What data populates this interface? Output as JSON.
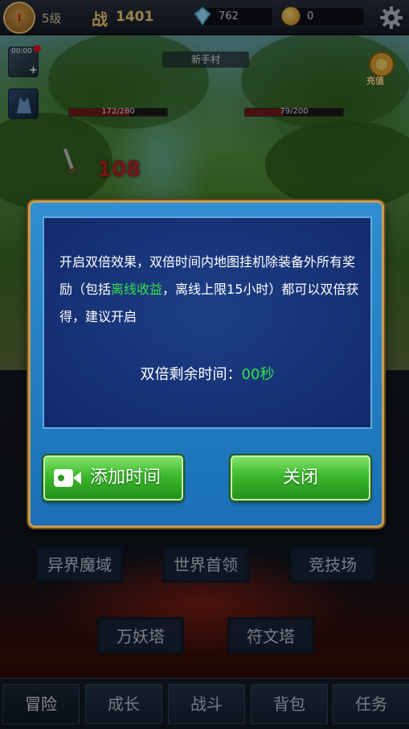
{
  "top_bar": {
    "rank": "1",
    "level": "5级",
    "power_icon": "战",
    "power": "1401",
    "diamonds": "762",
    "gold": "0"
  },
  "scene": {
    "map_name": "新手村",
    "timer": "00:00",
    "recharge_label": "充值",
    "player_hp": "172/280",
    "enemy_hp": "79/200",
    "player_hp_fraction": 0.614,
    "enemy_hp_fraction": 0.395,
    "damage": "108"
  },
  "dialog": {
    "text_before": "开启双倍效果，双倍时间内地图挂机除装备外所有奖励（包括",
    "text_highlight": "离线收益",
    "text_after": "，离线上限15小时）都可以双倍获得，建议开启",
    "timer_label": "双倍剩余时间：",
    "timer_value": "00秒",
    "add_time_label": "添加时间",
    "close_label": "关闭"
  },
  "menu": {
    "row1": [
      "异界魔域",
      "世界首领",
      "竞技场"
    ],
    "row2": [
      "万妖塔",
      "符文塔"
    ]
  },
  "tabs": [
    "冒险",
    "成长",
    "战斗",
    "背包",
    "任务"
  ],
  "colors": {
    "highlight_green": "#35e04a",
    "button_green": "#3cb82c",
    "dialog_blue": "#1a6fb5",
    "gold_border": "#c99b4e"
  }
}
